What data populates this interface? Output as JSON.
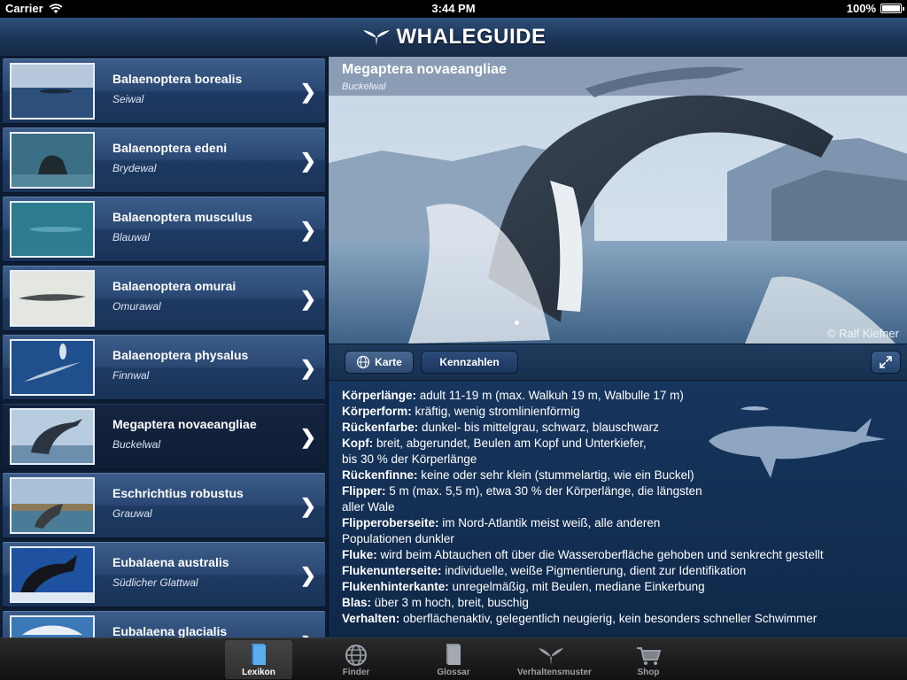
{
  "status": {
    "carrier": "Carrier",
    "time": "3:44 PM",
    "battery": "100%"
  },
  "app": {
    "title": "WHALEGUIDE"
  },
  "list": [
    {
      "latin": "Balaenoptera borealis",
      "common": "Seiwal"
    },
    {
      "latin": "Balaenoptera edeni",
      "common": "Brydewal"
    },
    {
      "latin": "Balaenoptera musculus",
      "common": "Blauwal"
    },
    {
      "latin": "Balaenoptera omurai",
      "common": "Omurawal"
    },
    {
      "latin": "Balaenoptera physalus",
      "common": "Finnwal"
    },
    {
      "latin": "Megaptera novaeangliae",
      "common": "Buckelwal",
      "selected": true
    },
    {
      "latin": "Eschrichtius robustus",
      "common": "Grauwal"
    },
    {
      "latin": "Eubalaena australis",
      "common": "Südlicher Glattwal"
    },
    {
      "latin": "Eubalaena glacialis",
      "common": ""
    }
  ],
  "detail": {
    "title": "Megaptera novaeangliae",
    "subtitle": "Buckelwal",
    "credit": "© Ralf Kiefner",
    "buttons": {
      "map": "Karte",
      "stats": "Kennzahlen"
    },
    "facts": [
      {
        "label": "Körperlänge:",
        "text": " adult 11-19 m (max. Walkuh 19 m, Walbulle 17 m)"
      },
      {
        "label": "Körperform:",
        "text": " kräftig, wenig stromlinienförmig"
      },
      {
        "label": "Rückenfarbe:",
        "text": " dunkel- bis mittelgrau, schwarz, blauschwarz"
      },
      {
        "label": "Kopf:",
        "text": " breit, abgerundet, Beulen am Kopf und Unterkiefer,"
      },
      {
        "label": "",
        "text": "bis 30 % der Körperlänge"
      },
      {
        "label": "Rückenfinne:",
        "text": " keine oder sehr klein (stummelartig, wie ein Buckel)"
      },
      {
        "label": "Flipper:",
        "text": " 5 m (max. 5,5 m), etwa 30 % der Körperlänge, die längsten"
      },
      {
        "label": "",
        "text": "aller Wale"
      },
      {
        "label": "Flipperoberseite:",
        "text": " im Nord-Atlantik meist weiß, alle anderen"
      },
      {
        "label": "",
        "text": "Populationen dunkler"
      },
      {
        "label": "Fluke:",
        "text": " wird beim Abtauchen oft über die Wasseroberfläche gehoben und senkrecht gestellt"
      },
      {
        "label": "Flukenunterseite:",
        "text": " individuelle, weiße Pigmentierung, dient zur Identifikation"
      },
      {
        "label": "Flukenhinterkante:",
        "text": " unregelmäßig, mit Beulen, mediane Einkerbung"
      },
      {
        "label": "Blas:",
        "text": " über 3 m hoch, breit, buschig"
      },
      {
        "label": "Verhalten:",
        "text": " oberflächenaktiv, gelegentlich neugierig, kein besonders schneller Schwimmer"
      }
    ]
  },
  "tabs": [
    {
      "label": "Lexikon",
      "icon": "book-icon",
      "active": true
    },
    {
      "label": "Finder",
      "icon": "globe-icon"
    },
    {
      "label": "Glossar",
      "icon": "glossary-book-icon"
    },
    {
      "label": "Verhaltensmuster",
      "icon": "whale-tail-icon"
    },
    {
      "label": "Shop",
      "icon": "shopping-cart-icon"
    }
  ],
  "colors": {
    "nav": "#1b3457",
    "list_bg": "#0c1c33",
    "row": "#2a4873",
    "selected_row": "#142440"
  }
}
